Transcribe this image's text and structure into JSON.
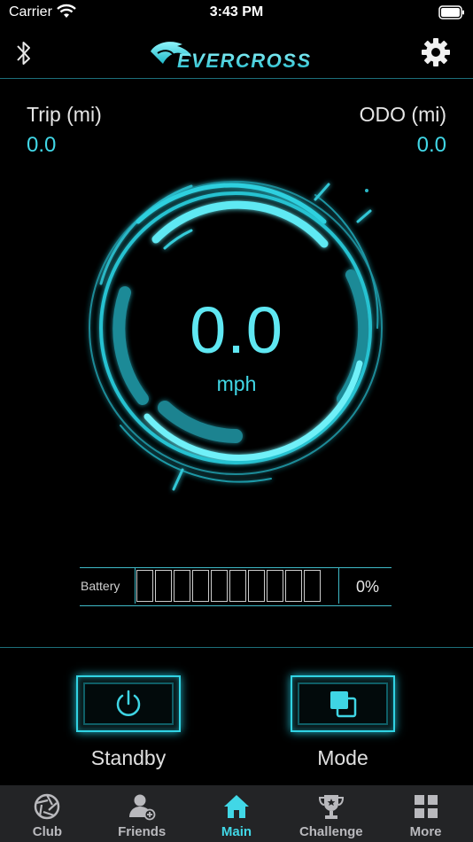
{
  "status_bar": {
    "carrier": "Carrier",
    "time": "3:43 PM"
  },
  "header": {
    "logo_text": "EVERCROSS"
  },
  "trip": {
    "label": "Trip (mi)",
    "value": "0.0"
  },
  "odo": {
    "label": "ODO (mi)",
    "value": "0.0"
  },
  "speed": {
    "value": "0.0",
    "unit": "mph"
  },
  "battery": {
    "label": "Battery",
    "percent": "0%",
    "level": 0,
    "cells": 10
  },
  "actions": {
    "standby_label": "Standby",
    "mode_label": "Mode"
  },
  "tabs": [
    {
      "label": "Club",
      "icon": "aperture-icon",
      "active": false
    },
    {
      "label": "Friends",
      "icon": "add-friend-icon",
      "active": false
    },
    {
      "label": "Main",
      "icon": "home-icon",
      "active": true
    },
    {
      "label": "Challenge",
      "icon": "trophy-icon",
      "active": false
    },
    {
      "label": "More",
      "icon": "grid-icon",
      "active": false
    }
  ],
  "colors": {
    "accent": "#41d7e6",
    "tab_bar_bg": "#232426",
    "background": "#000000"
  }
}
